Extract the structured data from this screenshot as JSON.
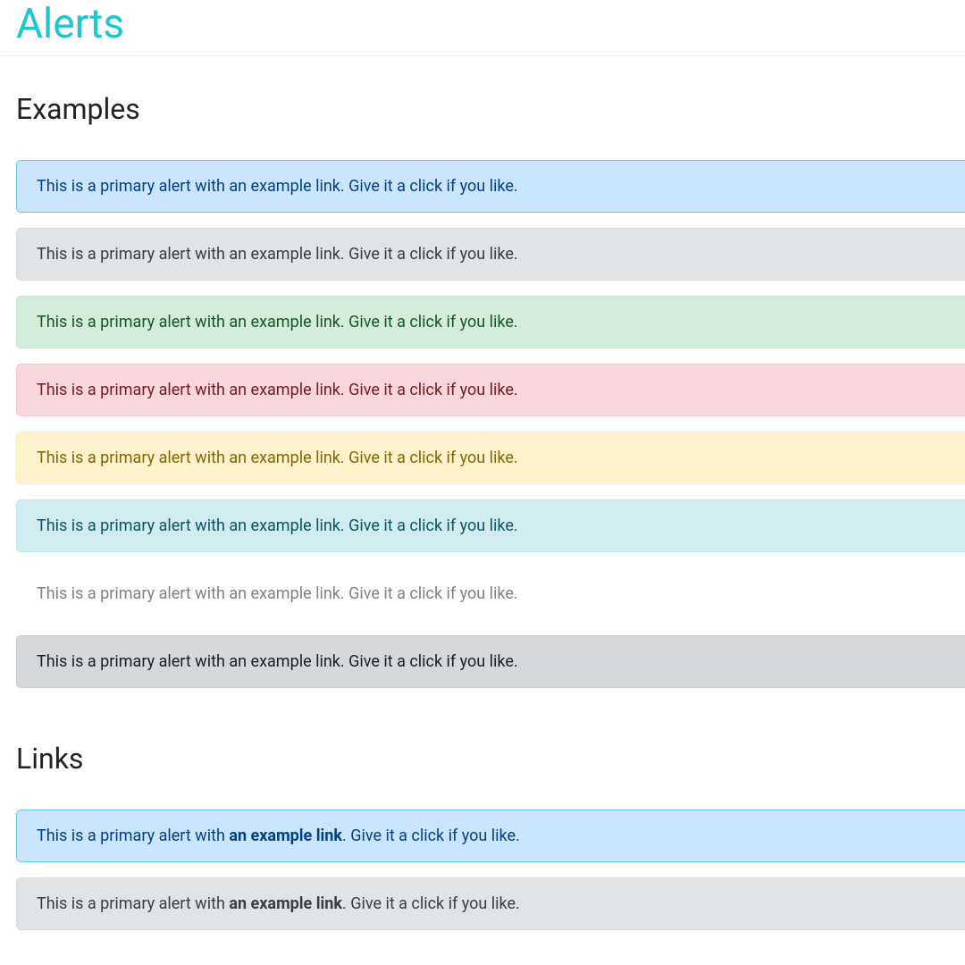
{
  "pageTitle": "Alerts",
  "sections": {
    "examples": {
      "heading": "Examples",
      "alerts": [
        {
          "variant": "primary",
          "text": "This is a primary alert with an example link. Give it a click if you like."
        },
        {
          "variant": "secondary",
          "text": "This is a primary alert with an example link. Give it a click if you like."
        },
        {
          "variant": "success",
          "text": "This is a primary alert with an example link. Give it a click if you like."
        },
        {
          "variant": "danger",
          "text": "This is a primary alert with an example link. Give it a click if you like."
        },
        {
          "variant": "warning",
          "text": "This is a primary alert with an example link. Give it a click if you like."
        },
        {
          "variant": "info",
          "text": "This is a primary alert with an example link. Give it a click if you like."
        },
        {
          "variant": "light",
          "text": "This is a primary alert with an example link. Give it a click if you like."
        },
        {
          "variant": "dark",
          "text": "This is a primary alert with an example link. Give it a click if you like."
        }
      ]
    },
    "links": {
      "heading": "Links",
      "alerts": [
        {
          "variant": "primary",
          "prefix": "This is a primary alert with ",
          "linkText": "an example link",
          "suffix": ". Give it a click if you like."
        },
        {
          "variant": "secondary",
          "prefix": "This is a primary alert with ",
          "linkText": "an example link",
          "suffix": ". Give it a click if you like."
        }
      ]
    }
  }
}
